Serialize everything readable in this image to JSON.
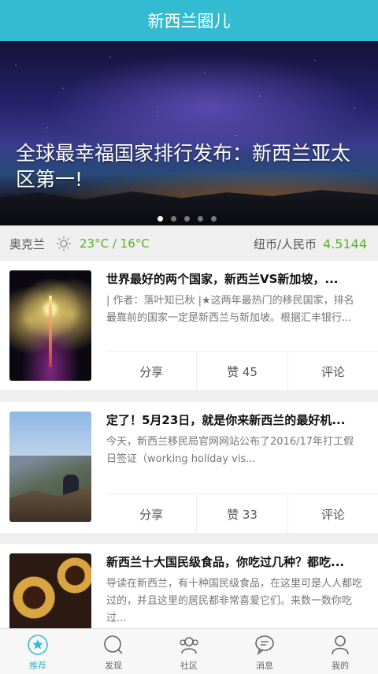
{
  "header": {
    "title": "新西兰圈儿"
  },
  "banner": {
    "headline": "全球最幸福国家排行发布：新西兰亚太区第一!",
    "dot_count": 5,
    "active_dot": 1
  },
  "info": {
    "city": "奥克兰",
    "weather_icon": "sun-icon",
    "temperature": "23°C / 16°C",
    "exchange_label": "纽币/人民币",
    "exchange_rate": "4.5144"
  },
  "articles": [
    {
      "title": "世界最好的两个国家，新西兰VS新加坡，...",
      "description": "| 作者：落叶知已秋 |★这两年最热门的移民国家，排名最靠前的国家一定是新西兰与新加坡。根据汇丰银行...",
      "share_label": "分享",
      "like_label": "赞 45",
      "comment_label": "评论"
    },
    {
      "title": "定了！5月23日，就是你来新西兰的最好机...",
      "description": "今天，新西兰移民局官网网站公布了2016/17年打工假日签证（working holiday vis...",
      "share_label": "分享",
      "like_label": "赞 33",
      "comment_label": "评论"
    },
    {
      "title": "新西兰十大国民级食品，你吃过几种？都吃...",
      "description": "导读在新西兰，有十种国民级食品，在这里可是人人都吃过的，并且这里的居民都非常喜爱它们。来数一数你吃过..."
    }
  ],
  "tabs": [
    {
      "label": "推荐",
      "icon": "star-icon",
      "active": true
    },
    {
      "label": "发现",
      "icon": "discover-icon",
      "active": false
    },
    {
      "label": "社区",
      "icon": "community-icon",
      "active": false
    },
    {
      "label": "消息",
      "icon": "message-icon",
      "active": false
    },
    {
      "label": "我的",
      "icon": "profile-icon",
      "active": false
    }
  ],
  "colors": {
    "accent": "#33bcd1",
    "green": "#5ab22a"
  }
}
